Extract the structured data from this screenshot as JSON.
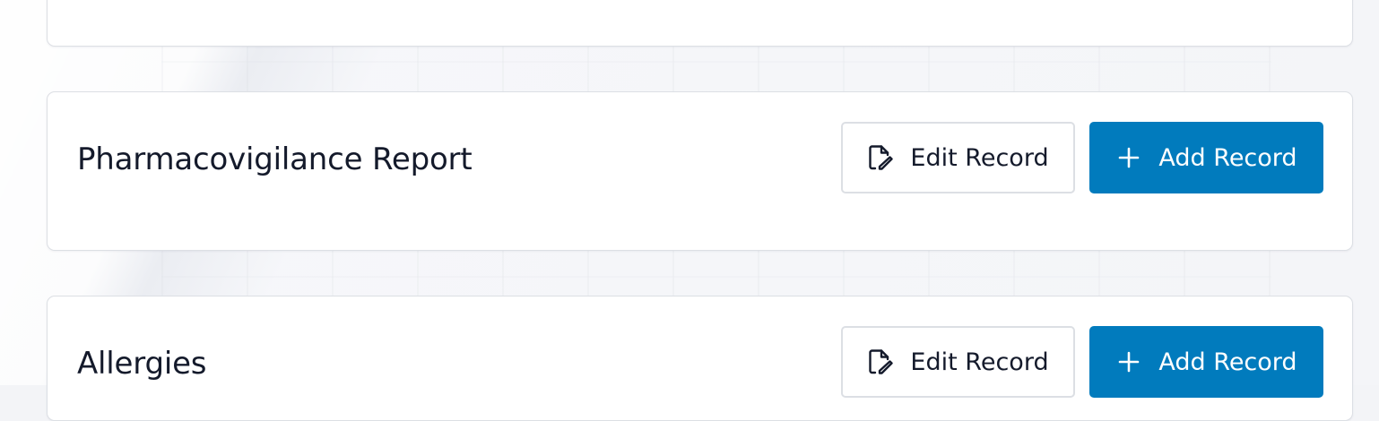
{
  "sections": [
    {
      "title": "Pharmacovigilance Report",
      "edit_label": "Edit Record",
      "add_label": "Add Record"
    },
    {
      "title": "Allergies",
      "edit_label": "Edit Record",
      "add_label": "Add Record"
    }
  ],
  "icons": {
    "edit": "file-edit-icon",
    "add": "plus-icon"
  },
  "colors": {
    "primary": "#017bbd",
    "text": "#141a2b",
    "border": "#dcdfe4"
  }
}
